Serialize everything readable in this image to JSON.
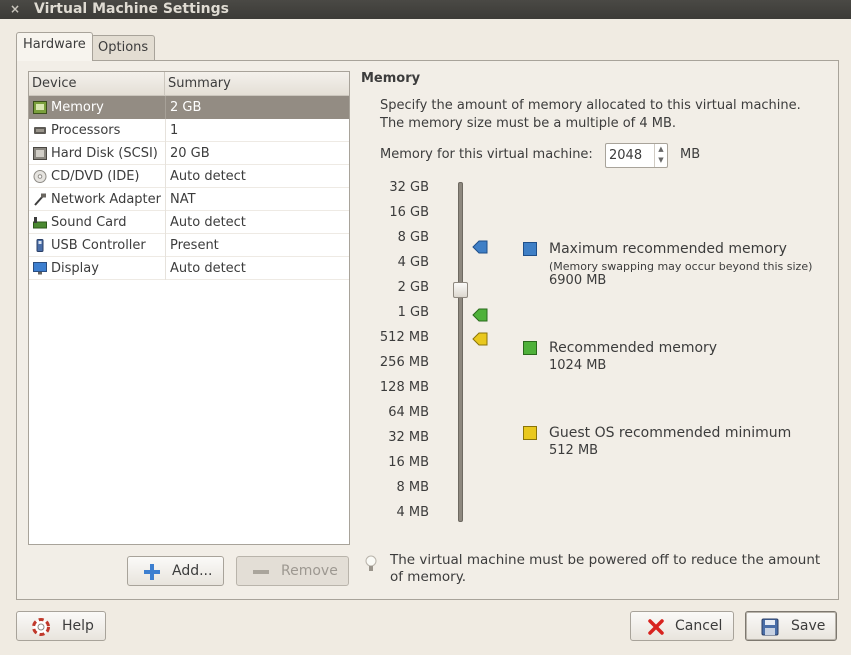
{
  "window": {
    "title": "Virtual Machine Settings",
    "close_glyph": "×"
  },
  "tabs": [
    {
      "label": "Hardware"
    },
    {
      "label": "Options"
    }
  ],
  "device_list": {
    "columns": {
      "device": "Device",
      "summary": "Summary"
    },
    "rows": [
      {
        "device": "Memory",
        "summary": "2 GB",
        "icon": "memory-icon",
        "selected": true
      },
      {
        "device": "Processors",
        "summary": "1",
        "icon": "processor-icon"
      },
      {
        "device": "Hard Disk (SCSI)",
        "summary": "20 GB",
        "icon": "hard-disk-icon"
      },
      {
        "device": "CD/DVD (IDE)",
        "summary": "Auto detect",
        "icon": "cd-dvd-icon"
      },
      {
        "device": "Network Adapter",
        "summary": "NAT",
        "icon": "network-adapter-icon"
      },
      {
        "device": "Sound Card",
        "summary": "Auto detect",
        "icon": "sound-card-icon"
      },
      {
        "device": "USB Controller",
        "summary": "Present",
        "icon": "usb-icon"
      },
      {
        "device": "Display",
        "summary": "Auto detect",
        "icon": "display-icon"
      }
    ]
  },
  "buttons": {
    "add": "Add...",
    "remove": "Remove",
    "help": "Help",
    "cancel": "Cancel",
    "save": "Save"
  },
  "memory": {
    "title": "Memory",
    "description_line1": "Specify the amount of memory allocated to this virtual machine.",
    "description_line2": "The memory size must be a multiple of 4 MB.",
    "field_label": "Memory for this virtual machine:",
    "value": "2048",
    "unit": "MB",
    "scale": [
      "32 GB",
      "16 GB",
      "8 GB",
      "4 GB",
      "2 GB",
      "1 GB",
      "512 MB",
      "256 MB",
      "128 MB",
      "64 MB",
      "32 MB",
      "16 MB",
      "8 MB",
      "4 MB"
    ],
    "legend": {
      "max": {
        "title": "Maximum recommended memory",
        "note": "(Memory swapping may occur beyond this size)",
        "value": "6900 MB",
        "color": "#3f7fc6"
      },
      "recommended": {
        "title": "Recommended memory",
        "value": "1024 MB",
        "color": "#4fb13a"
      },
      "minimum": {
        "title": "Guest OS recommended minimum",
        "value": "512 MB",
        "color": "#e9c81e"
      }
    },
    "note": "The virtual machine must be powered off to reduce the amount of memory."
  }
}
